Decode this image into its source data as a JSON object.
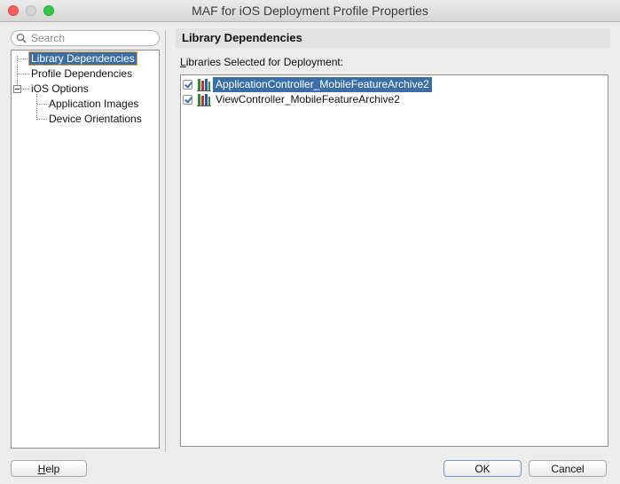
{
  "window": {
    "title": "MAF for iOS Deployment Profile Properties"
  },
  "search": {
    "placeholder": "Search",
    "value": ""
  },
  "nav": {
    "items": [
      {
        "label": "Library Dependencies",
        "selected": true
      },
      {
        "label": "Profile Dependencies"
      },
      {
        "label": "iOS Options",
        "expanded": true
      },
      {
        "label": "Application Images"
      },
      {
        "label": "Device Orientations"
      }
    ]
  },
  "panel": {
    "title": "Library Dependencies",
    "subhead_mnemonic": "L",
    "subhead_rest": "ibraries Selected for Deployment:",
    "libraries": [
      {
        "name": "ApplicationController_MobileFeatureArchive2",
        "checked": true,
        "selected": true
      },
      {
        "name": "ViewController_MobileFeatureArchive2",
        "checked": true,
        "selected": false
      }
    ]
  },
  "buttons": {
    "help_mnemonic": "H",
    "help_rest": "elp",
    "ok": "OK",
    "cancel": "Cancel"
  },
  "colors": {
    "selection": "#3b6ea6",
    "focus_outline": "#e0a33a",
    "close": "#fc605c",
    "maximize": "#34c84a"
  }
}
